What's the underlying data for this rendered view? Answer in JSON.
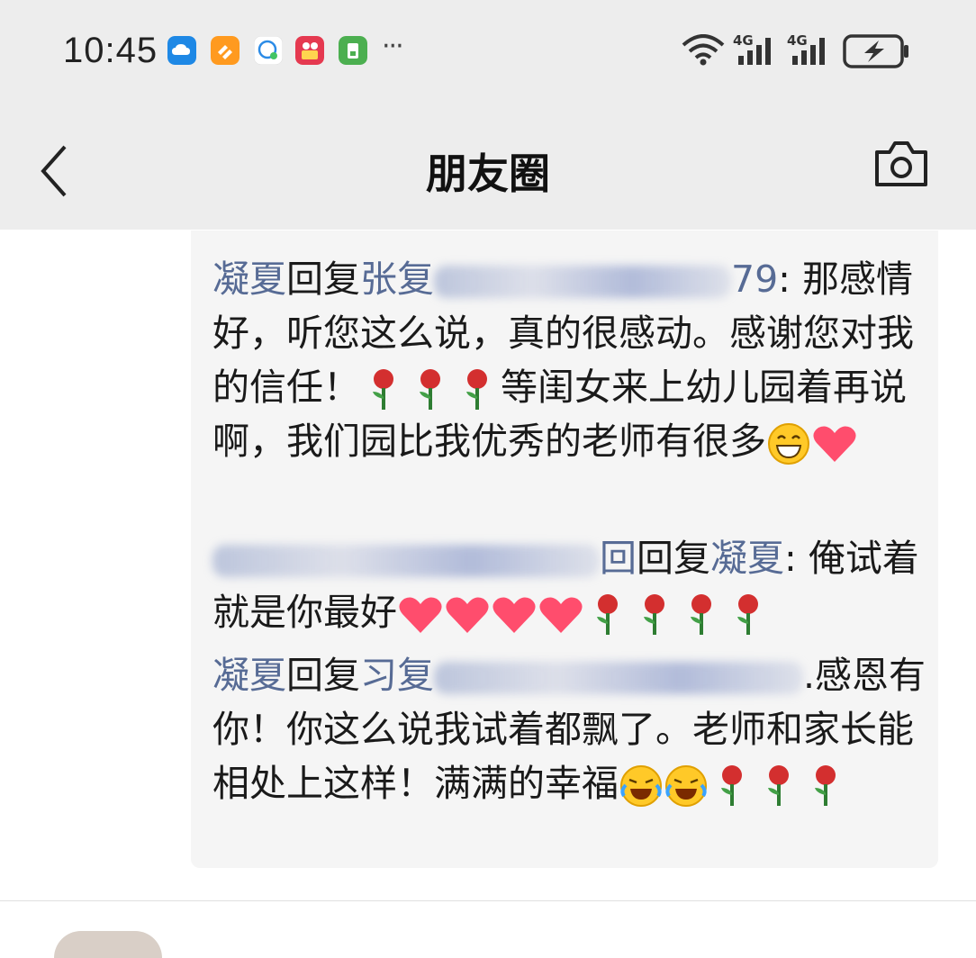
{
  "status_bar": {
    "time": "10:45",
    "notification_icons": [
      "cloud-app-icon",
      "orange-app-icon",
      "chat-app-icon",
      "video-app-icon",
      "green-app-icon"
    ],
    "more": "···",
    "network_1": "4G",
    "network_2": "4G"
  },
  "header": {
    "title": "朋友圈",
    "back_icon": "chevron-left-icon",
    "camera_icon": "camera-icon"
  },
  "comments": [
    {
      "author": "凝夏",
      "reply_word": "回复",
      "target_visible": "张复",
      "target_tail": "79",
      "colon": ": ",
      "text": "那感情好，听您这么说，真的很感动。感谢您对我的信任！",
      "text_2": "等闺女来上幼儿园着再说啊，我们园比我优秀的老师有很多"
    },
    {
      "author_tail": "回",
      "reply_word": "回复",
      "target": "凝夏",
      "colon": ": ",
      "text": "俺试着就是你最好"
    },
    {
      "author": "凝夏",
      "reply_word": "回复",
      "target_visible": "习复",
      "target_tail": ".",
      "text": "感恩有你！你这么说我试着都飘了。老师和家长能相处上这样！满满的幸福"
    }
  ],
  "colors": {
    "link_name": "#576b95",
    "bar_background": "#ededed",
    "comment_background": "#f5f5f5"
  }
}
